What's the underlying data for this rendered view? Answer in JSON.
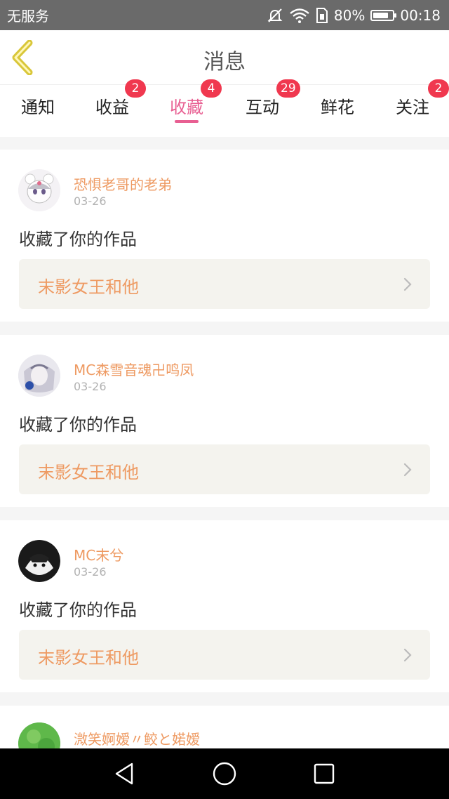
{
  "status_bar": {
    "carrier": "无服务",
    "battery_percent": "80%",
    "battery_level": 0.8,
    "time": "00:18",
    "icons": [
      "mute-icon",
      "wifi-icon",
      "sim-icon",
      "battery-icon"
    ]
  },
  "header": {
    "title": "消息",
    "back_icon": "chevron-left-icon"
  },
  "colors": {
    "accent_pink": "#e85f92",
    "username_orange": "#ee9a62",
    "badge_red": "#f0384f"
  },
  "tabs": [
    {
      "label": "通知",
      "badge": ""
    },
    {
      "label": "收益",
      "badge": "2"
    },
    {
      "label": "收藏",
      "badge": "4",
      "active": true
    },
    {
      "label": "互动",
      "badge": "29"
    },
    {
      "label": "鲜花",
      "badge": ""
    },
    {
      "label": "关注",
      "badge": "2"
    }
  ],
  "messages": [
    {
      "username": "恐惧老哥的老弟",
      "date": "03-26",
      "action": "收藏了你的作品",
      "work_title": "末影女王和他"
    },
    {
      "username": "MC森雪音魂卍鸣凤",
      "date": "03-26",
      "action": "收藏了你的作品",
      "work_title": "末影女王和他"
    },
    {
      "username": "MC末兮",
      "date": "03-26",
      "action": "收藏了你的作品",
      "work_title": "末影女王和他"
    },
    {
      "username": "溦笑婀嫒〃鲛と婼�republic",
      "date": "",
      "action": "",
      "work_title": ""
    }
  ],
  "nav_bar": {
    "icons": [
      "back-triangle-icon",
      "home-circle-icon",
      "recents-square-icon"
    ]
  }
}
